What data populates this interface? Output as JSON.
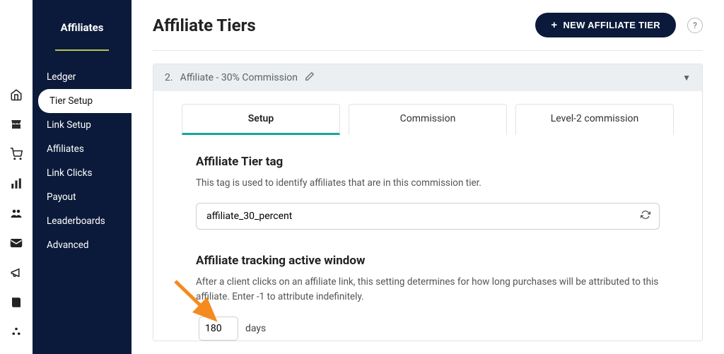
{
  "sidebar": {
    "title": "Affiliates",
    "items": [
      {
        "label": "Ledger",
        "active": false
      },
      {
        "label": "Tier Setup",
        "active": true
      },
      {
        "label": "Link Setup",
        "active": false
      },
      {
        "label": "Affiliates",
        "active": false
      },
      {
        "label": "Link Clicks",
        "active": false
      },
      {
        "label": "Payout",
        "active": false
      },
      {
        "label": "Leaderboards",
        "active": false
      },
      {
        "label": "Advanced",
        "active": false
      }
    ]
  },
  "header": {
    "page_title": "Affiliate Tiers",
    "new_button_label": "NEW AFFILIATE TIER",
    "help_char": "?"
  },
  "tier": {
    "number": "2",
    "name": "Affiliate - 30% Commission",
    "tabs": [
      {
        "label": "Setup",
        "active": true
      },
      {
        "label": "Commission",
        "active": false
      },
      {
        "label": "Level-2 commission",
        "active": false
      }
    ]
  },
  "tag_section": {
    "heading": "Affiliate Tier tag",
    "description": "This tag is used to identify affiliates that are in this commission tier.",
    "value": "affiliate_30_percent"
  },
  "window_section": {
    "heading": "Affiliate tracking active window",
    "description": "After a client clicks on an affiliate link, this setting determines for how long purchases will be attributed to this affiliate. Enter -1 to attribute indefinitely.",
    "days_value": "180",
    "days_suffix": "days"
  }
}
